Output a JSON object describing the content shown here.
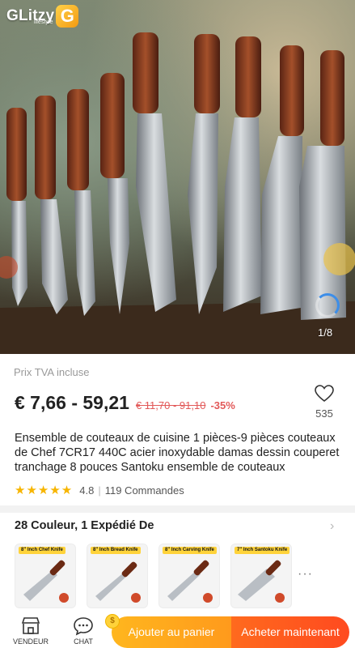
{
  "brand": {
    "name": "GLitzy",
    "badge": "G",
    "sub": "lifestyle"
  },
  "gallery": {
    "counter": "1/8"
  },
  "pricing": {
    "vat_note": "Prix TVA incluse",
    "price_range": "€ 7,66 - 59,21",
    "old_price": "€ 11,70 - 91,10",
    "discount": "-35%"
  },
  "favorites": {
    "count": "535"
  },
  "product": {
    "title": "Ensemble de couteaux de cuisine 1 pièces-9 pièces couteaux de Chef 7CR17 440C acier inoxydable damas dessin couperet tranchage 8 pouces Santoku ensemble de couteaux",
    "rating": "4.8",
    "rating_stars": 5,
    "orders": "119 Commandes"
  },
  "variants": {
    "header": "28 Couleur, 1 Expédié De",
    "items": [
      {
        "tag": "8\" Inch Chef Knife"
      },
      {
        "tag": "8\" Inch Bread Knife"
      },
      {
        "tag": "8\" Inch Carving Knife"
      },
      {
        "tag": "7\" Inch Santoku Knife"
      }
    ],
    "more": "···"
  },
  "bottom_bar": {
    "store_label": "VENDEUR",
    "chat_label": "CHAT",
    "cart_label": "Ajouter au panier",
    "buy_label": "Acheter maintenant"
  },
  "colors": {
    "price_red": "#e25959",
    "star": "#f7b500",
    "cart_orange": "#ffa81d",
    "buy_orange": "#ff5a1f",
    "spinner_blue": "#3d8ee8"
  }
}
